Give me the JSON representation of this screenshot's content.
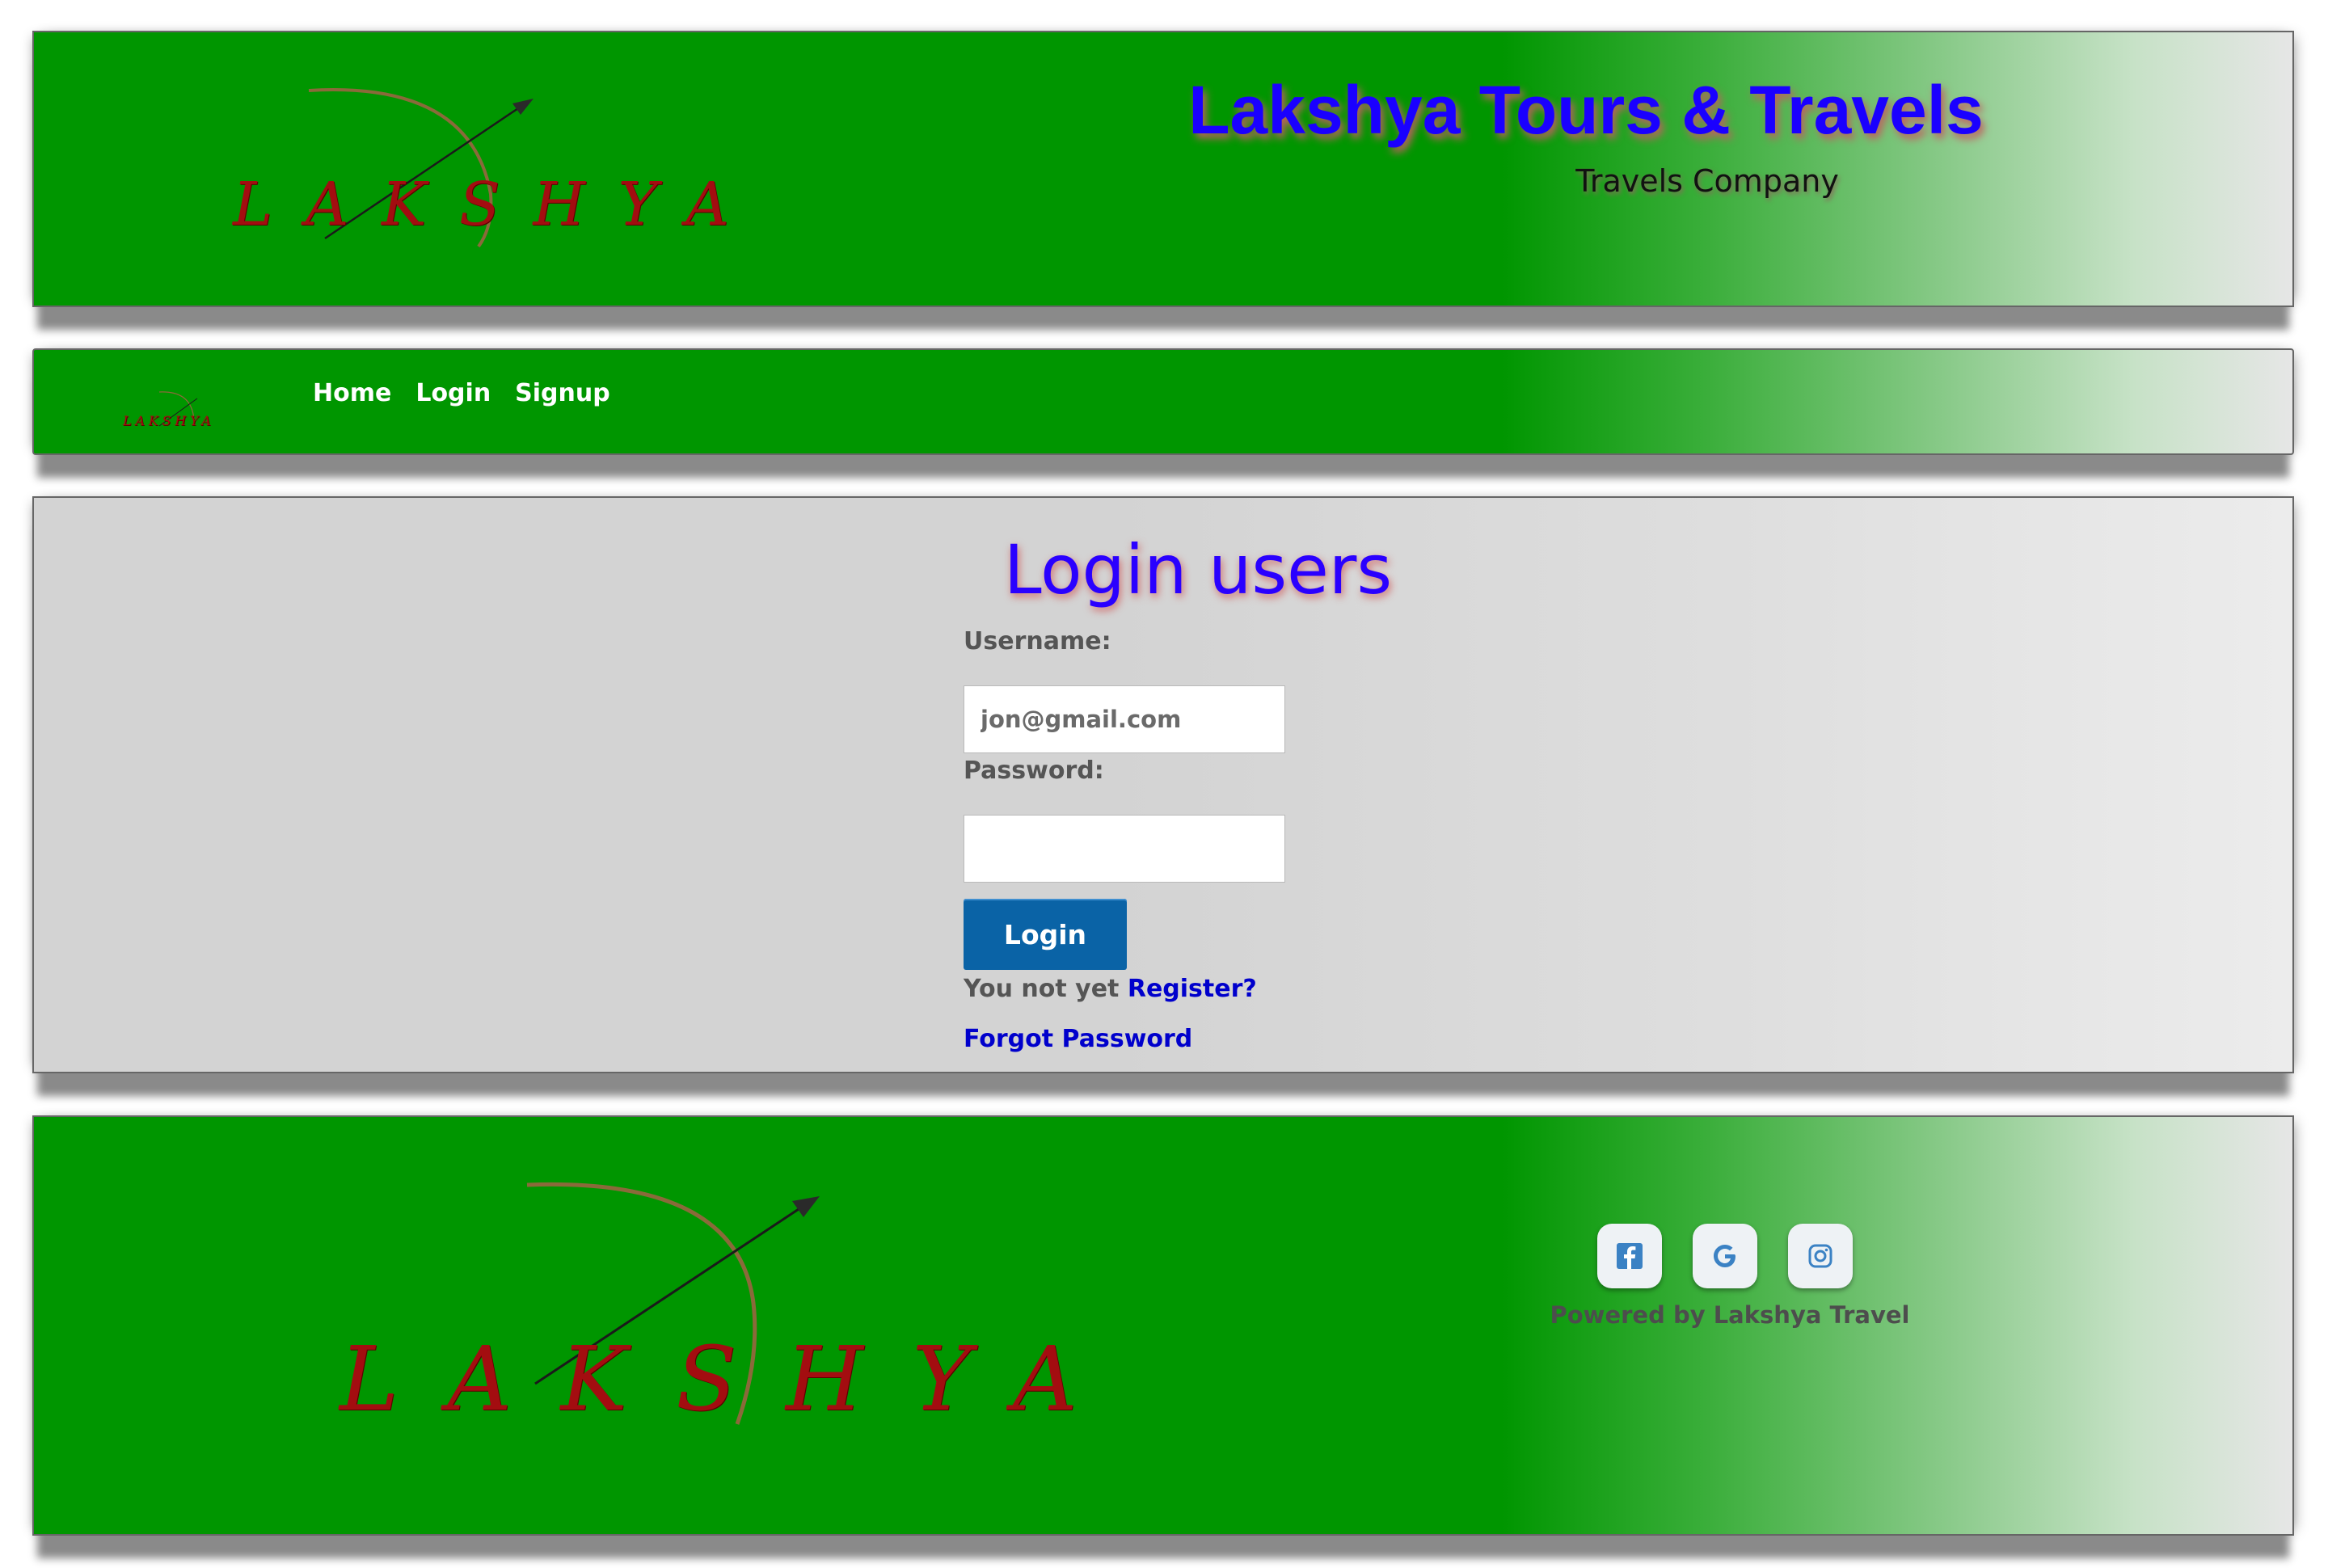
{
  "header": {
    "logo_text": "LAKSHYA",
    "title": "Lakshya Tours & Travels",
    "subtitle": "Travels Company"
  },
  "nav": {
    "logo_text": "LAKSHYA",
    "links": [
      "Home",
      "Login",
      "Signup"
    ]
  },
  "login_form": {
    "title": "Login users",
    "username_label": "Username:",
    "username_placeholder": "jon@gmail.com",
    "password_label": "Password:",
    "password_value": "",
    "submit_label": "Login",
    "register_prompt": "You not yet",
    "register_link": "Register?",
    "forgot_link": "Forgot Password"
  },
  "footer": {
    "logo_text": "LAKSHYA",
    "social_icons": [
      "facebook-icon",
      "google-icon",
      "instagram-icon"
    ],
    "powered_by": "Powered by Lakshya Travel"
  },
  "colors": {
    "brand_green": "#009600",
    "title_blue": "#1a00ff",
    "button_blue": "#0a63a6",
    "link_blue": "#0000cc",
    "logo_red": "#a30d10"
  }
}
